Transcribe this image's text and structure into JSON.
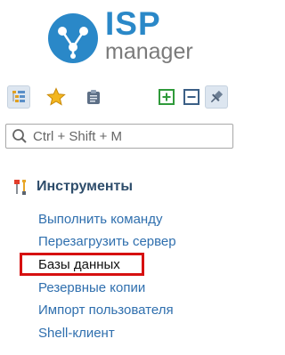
{
  "logo": {
    "brand": "ISP",
    "product": "manager"
  },
  "search": {
    "placeholder": "Ctrl + Shift + M"
  },
  "toolbar": {
    "buttons": [
      {
        "icon": "tree-view-icon",
        "active": true
      },
      {
        "icon": "star-icon",
        "active": false
      },
      {
        "icon": "clipboard-icon",
        "active": false
      },
      {
        "icon": "expand-plus-icon",
        "active": false
      },
      {
        "icon": "collapse-minus-icon",
        "active": false
      },
      {
        "icon": "pin-icon",
        "active": true
      }
    ]
  },
  "section": {
    "title": "Инструменты",
    "icon": "tools-icon",
    "items": [
      {
        "label": "Выполнить команду"
      },
      {
        "label": "Перезагрузить сервер"
      },
      {
        "label": "Базы данных",
        "selected": true
      },
      {
        "label": "Резервные копии"
      },
      {
        "label": "Импорт пользователя"
      },
      {
        "label": "Shell-клиент"
      }
    ]
  },
  "colors": {
    "brand_blue": "#2a88c8",
    "link": "#2f6fae",
    "section_title": "#2e4d6b",
    "highlight": "#d61010"
  }
}
